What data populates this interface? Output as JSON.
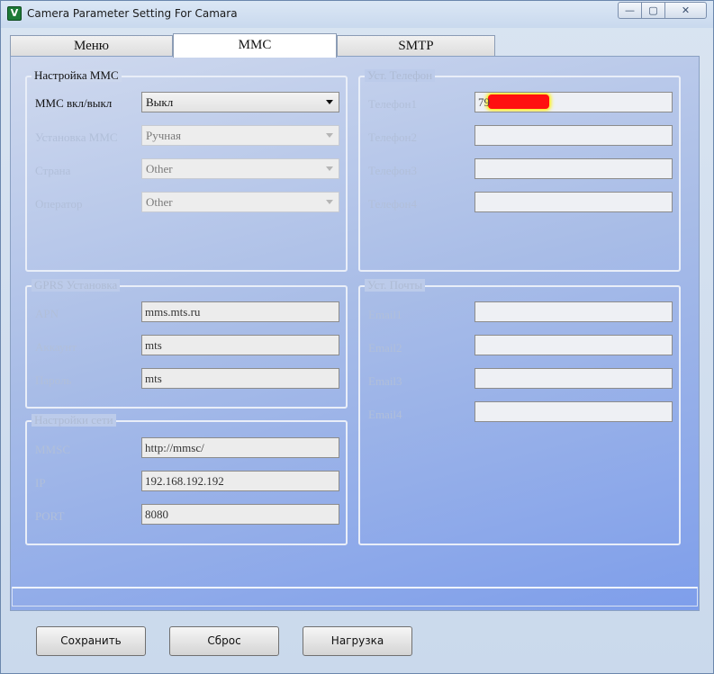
{
  "window": {
    "title": "Camera Parameter Setting For  Camara",
    "icon_text": "V",
    "minimize": "—",
    "maximize": "▢",
    "close": "✕"
  },
  "tabs": [
    {
      "label": "Меню"
    },
    {
      "label": "MMC"
    },
    {
      "label": "SMTP"
    }
  ],
  "mms_settings": {
    "title": "Настройка MMC",
    "rows": [
      {
        "label": "MMC вкл/выкл",
        "value": "Выкл"
      },
      {
        "label": "Установка MMC",
        "value": "Ручная"
      },
      {
        "label": "Страна",
        "value": "Other"
      },
      {
        "label": "Оператор",
        "value": "Other"
      }
    ]
  },
  "phones": {
    "title": "Уст. Телефон",
    "rows": [
      {
        "label": "Телефон1",
        "value": "79"
      },
      {
        "label": "Телефон2",
        "value": ""
      },
      {
        "label": "Телефон3",
        "value": ""
      },
      {
        "label": "Телефон4",
        "value": ""
      }
    ]
  },
  "gprs": {
    "title": "GPRS Установка",
    "rows": [
      {
        "label": "APN",
        "value": "mms.mts.ru"
      },
      {
        "label": "Аккаунт",
        "value": "mts"
      },
      {
        "label": "Пароль",
        "value": "mts"
      }
    ]
  },
  "mail": {
    "title": "Уст. Почты",
    "rows": [
      {
        "label": "Email1",
        "value": ""
      },
      {
        "label": "Email2",
        "value": ""
      },
      {
        "label": "Email3",
        "value": ""
      },
      {
        "label": "Email4",
        "value": ""
      }
    ]
  },
  "network": {
    "title": "Настройки сети",
    "rows": [
      {
        "label": "MMSC",
        "value": "http://mmsc/"
      },
      {
        "label": "IP",
        "value": "192.168.192.192"
      },
      {
        "label": "PORT",
        "value": "8080"
      }
    ]
  },
  "buttons": {
    "save": "Сохранить",
    "reset": "Сброс",
    "load": "Нагрузка"
  }
}
